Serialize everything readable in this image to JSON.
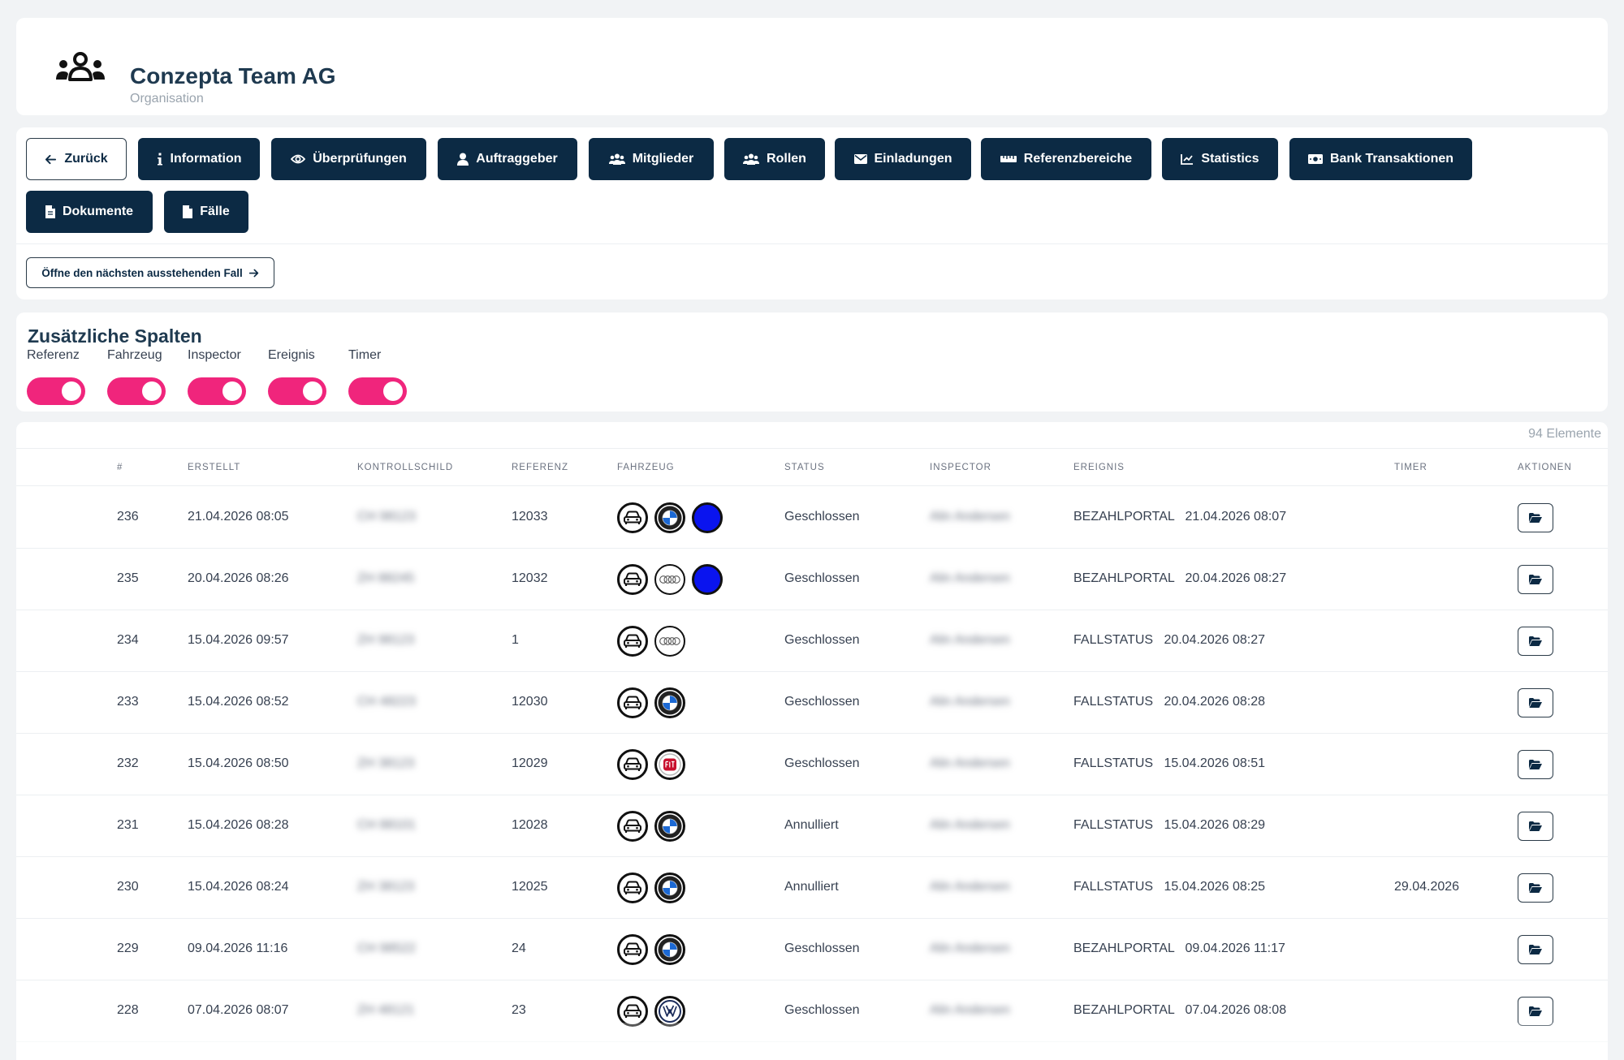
{
  "header": {
    "title": "Conzepta Team AG",
    "subtitle": "Organisation",
    "icon": "users-group-icon"
  },
  "nav": {
    "back": "Zurück",
    "information": "Information",
    "checks": "Überprüfungen",
    "clients": "Auftraggeber",
    "members": "Mitglieder",
    "roles": "Rollen",
    "invitations": "Einladungen",
    "reference_areas": "Referenzbereiche",
    "statistics": "Statistics",
    "bank": "Bank Transaktionen",
    "documents": "Dokumente",
    "cases": "Fälle",
    "next_case": "Öffne den nächsten ausstehenden Fall"
  },
  "extra_columns": {
    "title": "Zusätzliche Spalten",
    "toggles": [
      {
        "label": "Referenz",
        "on": true
      },
      {
        "label": "Fahrzeug",
        "on": true
      },
      {
        "label": "Inspector",
        "on": true
      },
      {
        "label": "Ereignis",
        "on": true
      },
      {
        "label": "Timer",
        "on": true
      }
    ]
  },
  "table": {
    "count": "94 Elemente",
    "headers": {
      "id": "#",
      "created": "ERSTELLT",
      "plate": "KONTROLLSCHILD",
      "reference": "REFERENZ",
      "vehicle": "FAHRZEUG",
      "status": "STATUS",
      "inspector": "INSPECTOR",
      "event": "EREIGNIS",
      "timer": "TIMER",
      "actions": "AKTIONEN"
    },
    "rows": [
      {
        "id": "236",
        "created": "21.04.2026 08:05",
        "plate": "CH 98123",
        "reference": "12033",
        "brand": "bmw",
        "color": "blue",
        "status": "Geschlossen",
        "inspector": "Alin Andersen",
        "event": "BEZAHLPORTAL   21.04.2026 08:07",
        "timer": ""
      },
      {
        "id": "235",
        "created": "20.04.2026 08:26",
        "plate": "ZH 88245",
        "reference": "12032",
        "brand": "audi",
        "color": "blue",
        "status": "Geschlossen",
        "inspector": "Alin Andersen",
        "event": "BEZAHLPORTAL   20.04.2026 08:27",
        "timer": ""
      },
      {
        "id": "234",
        "created": "15.04.2026 09:57",
        "plate": "ZH 98123",
        "reference": "1",
        "brand": "audi",
        "color": "",
        "status": "Geschlossen",
        "inspector": "Alin Andersen",
        "event": "FALLSTATUS   20.04.2026 08:27",
        "timer": ""
      },
      {
        "id": "233",
        "created": "15.04.2026 08:52",
        "plate": "CH 48223",
        "reference": "12030",
        "brand": "bmw",
        "color": "",
        "status": "Geschlossen",
        "inspector": "Alin Andersen",
        "event": "FALLSTATUS   20.04.2026 08:28",
        "timer": ""
      },
      {
        "id": "232",
        "created": "15.04.2026 08:50",
        "plate": "ZH 38123",
        "reference": "12029",
        "brand": "fiat",
        "color": "",
        "status": "Geschlossen",
        "inspector": "Alin Andersen",
        "event": "FALLSTATUS   15.04.2026 08:51",
        "timer": ""
      },
      {
        "id": "231",
        "created": "15.04.2026 08:28",
        "plate": "CH 88101",
        "reference": "12028",
        "brand": "bmw",
        "color": "",
        "status": "Annulliert",
        "inspector": "Alin Andersen",
        "event": "FALLSTATUS   15.04.2026 08:29",
        "timer": ""
      },
      {
        "id": "230",
        "created": "15.04.2026 08:24",
        "plate": "ZH 38123",
        "reference": "12025",
        "brand": "bmw",
        "color": "",
        "status": "Annulliert",
        "inspector": "Alin Andersen",
        "event": "FALLSTATUS   15.04.2026 08:25",
        "timer": "29.04.2026"
      },
      {
        "id": "229",
        "created": "09.04.2026 11:16",
        "plate": "CH 98522",
        "reference": "24",
        "brand": "bmw",
        "color": "",
        "status": "Geschlossen",
        "inspector": "Alin Andersen",
        "event": "BEZAHLPORTAL   09.04.2026 11:17",
        "timer": ""
      },
      {
        "id": "228",
        "created": "07.04.2026 08:07",
        "plate": "ZH 48121",
        "reference": "23",
        "brand": "vw",
        "color": "",
        "status": "Geschlossen",
        "inspector": "Alin Andersen",
        "event": "BEZAHLPORTAL   07.04.2026 08:08",
        "timer": ""
      }
    ]
  },
  "colors": {
    "primary": "#0c2a44",
    "toggle": "#f0257c",
    "background": "#f1f3f5",
    "vehicle_blue": "#0a14ef"
  }
}
